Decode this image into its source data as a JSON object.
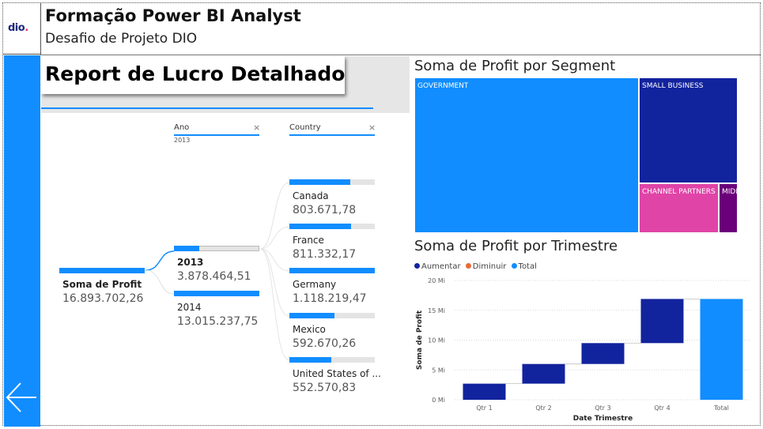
{
  "header": {
    "logo_text": "dio",
    "title": "Formação Power BI Analyst",
    "subtitle": "Desafio de Projeto DIO"
  },
  "report": {
    "title": "Report de Lucro Detalhado"
  },
  "decomposition": {
    "filters": [
      {
        "label": "Ano",
        "value": "2013"
      },
      {
        "label": "Country",
        "value": ""
      }
    ],
    "root": {
      "name": "Soma de Profit",
      "value": "16.893.702,26",
      "fill": 1.0
    },
    "years": [
      {
        "name": "2013",
        "value": "3.878.464,51",
        "fill": 0.3,
        "selected": true
      },
      {
        "name": "2014",
        "value": "13.015.237,75",
        "fill": 1.0,
        "selected": false
      }
    ],
    "countries": [
      {
        "name": "Canada",
        "value": "803.671,78",
        "fill": 0.71
      },
      {
        "name": "France",
        "value": "811.332,17",
        "fill": 0.72
      },
      {
        "name": "Germany",
        "value": "1.118.219,47",
        "fill": 1.0
      },
      {
        "name": "Mexico",
        "value": "592.670,26",
        "fill": 0.53
      },
      {
        "name": "United States of ...",
        "value": "552.570,83",
        "fill": 0.49
      }
    ]
  },
  "treemap": {
    "title": "Soma de Profit por Segment",
    "segments": [
      {
        "name": "GOVERNMENT",
        "color": "#118dff"
      },
      {
        "name": "SMALL BUSINESS",
        "color": "#12239e"
      },
      {
        "name": "CHANNEL PARTNERS",
        "color": "#e044a7"
      },
      {
        "name": "MIDMA...",
        "color": "#6b007b"
      }
    ]
  },
  "waterfall": {
    "title": "Soma de Profit por Trimestre",
    "legend": [
      {
        "label": "Aumentar",
        "color": "#12239e"
      },
      {
        "label": "Diminuir",
        "color": "#e66c37"
      },
      {
        "label": "Total",
        "color": "#118dff"
      }
    ]
  },
  "chart_data": {
    "type": "bar",
    "subtype": "waterfall",
    "title": "Soma de Profit por Trimestre",
    "xlabel": "Date Trimestre",
    "ylabel": "Soma de Profit",
    "categories": [
      "Qtr 1",
      "Qtr 2",
      "Qtr 3",
      "Qtr 4",
      "Total"
    ],
    "series": [
      {
        "name": "Aumentar",
        "values": [
          2.7,
          3.3,
          3.5,
          7.4,
          null
        ]
      },
      {
        "name": "Total",
        "values": [
          null,
          null,
          null,
          null,
          16.9
        ]
      }
    ],
    "unit": "Mi",
    "yticks": [
      "0 Mi",
      "5 Mi",
      "10 Mi",
      "15 Mi",
      "20 Mi"
    ],
    "ylim": [
      0,
      20
    ],
    "grid": true,
    "legend_position": "top-left"
  }
}
